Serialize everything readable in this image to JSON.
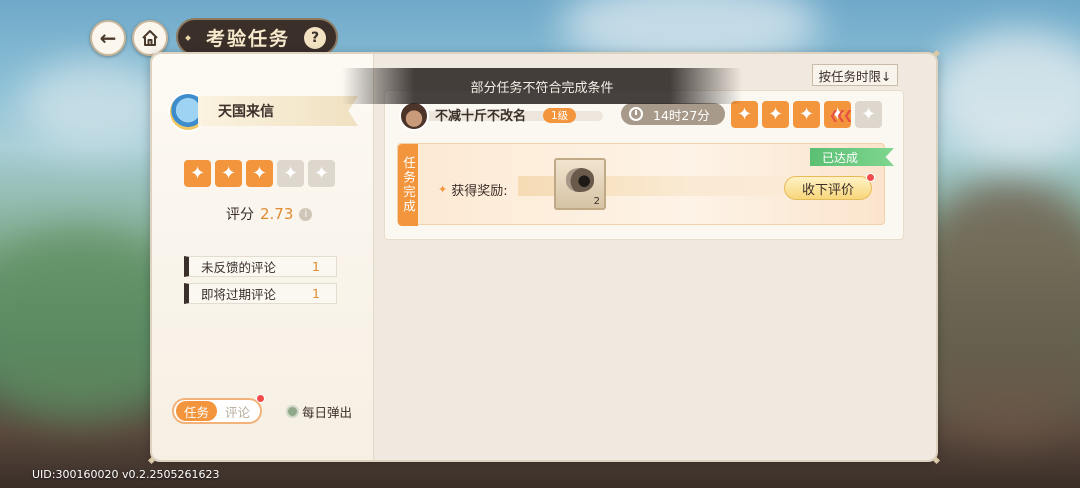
{
  "header": {
    "title": "考验任务",
    "help_label": "?",
    "back_icon": "arrow-left-icon",
    "home_icon": "home-icon"
  },
  "left_panel": {
    "name": "天国来信",
    "stars": {
      "filled": 3,
      "total": 5
    },
    "score_label": "评分",
    "score_value": "2.73",
    "feedback_rows": [
      {
        "label": "未反馈的评论",
        "count": "1"
      },
      {
        "label": "即将过期评论",
        "count": "1"
      }
    ],
    "toggle": {
      "active": "任务",
      "inactive": "评论"
    },
    "daily_popup_label": "每日弹出"
  },
  "toolbar": {
    "sort_label": "按任务时限↓"
  },
  "toast": {
    "message": "部分任务不符合完成条件"
  },
  "task": {
    "name": "不减十斤不改名",
    "level": "1级",
    "timer": "14时27分",
    "stars": {
      "filled": 4,
      "total": 5
    },
    "status_side": "任务完成",
    "achieved_label": "已达成",
    "reward_label": "获得奖励:",
    "reward_quantity": "2",
    "collect_label": "收下评价"
  },
  "footer": {
    "uid": "UID:300160020 v0.2.2505261623"
  },
  "colors": {
    "accent": "#f2953d",
    "dark": "#3b2f2a",
    "achieved": "#5bbf73"
  }
}
